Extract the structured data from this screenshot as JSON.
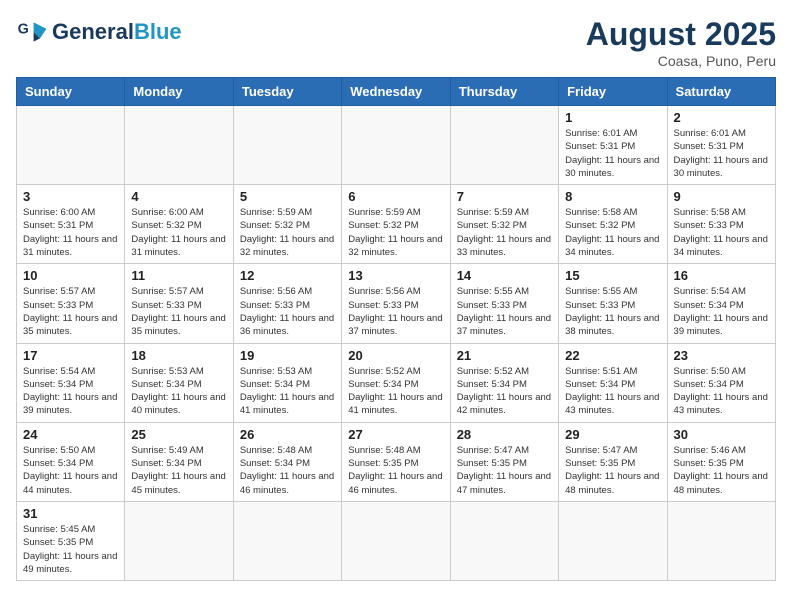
{
  "header": {
    "logo_general": "General",
    "logo_blue": "Blue",
    "title": "August 2025",
    "subtitle": "Coasa, Puno, Peru"
  },
  "days_of_week": [
    "Sunday",
    "Monday",
    "Tuesday",
    "Wednesday",
    "Thursday",
    "Friday",
    "Saturday"
  ],
  "weeks": [
    [
      {
        "day": "",
        "info": ""
      },
      {
        "day": "",
        "info": ""
      },
      {
        "day": "",
        "info": ""
      },
      {
        "day": "",
        "info": ""
      },
      {
        "day": "",
        "info": ""
      },
      {
        "day": "1",
        "info": "Sunrise: 6:01 AM\nSunset: 5:31 PM\nDaylight: 11 hours\nand 30 minutes."
      },
      {
        "day": "2",
        "info": "Sunrise: 6:01 AM\nSunset: 5:31 PM\nDaylight: 11 hours\nand 30 minutes."
      }
    ],
    [
      {
        "day": "3",
        "info": "Sunrise: 6:00 AM\nSunset: 5:31 PM\nDaylight: 11 hours\nand 31 minutes."
      },
      {
        "day": "4",
        "info": "Sunrise: 6:00 AM\nSunset: 5:32 PM\nDaylight: 11 hours\nand 31 minutes."
      },
      {
        "day": "5",
        "info": "Sunrise: 5:59 AM\nSunset: 5:32 PM\nDaylight: 11 hours\nand 32 minutes."
      },
      {
        "day": "6",
        "info": "Sunrise: 5:59 AM\nSunset: 5:32 PM\nDaylight: 11 hours\nand 32 minutes."
      },
      {
        "day": "7",
        "info": "Sunrise: 5:59 AM\nSunset: 5:32 PM\nDaylight: 11 hours\nand 33 minutes."
      },
      {
        "day": "8",
        "info": "Sunrise: 5:58 AM\nSunset: 5:32 PM\nDaylight: 11 hours\nand 34 minutes."
      },
      {
        "day": "9",
        "info": "Sunrise: 5:58 AM\nSunset: 5:33 PM\nDaylight: 11 hours\nand 34 minutes."
      }
    ],
    [
      {
        "day": "10",
        "info": "Sunrise: 5:57 AM\nSunset: 5:33 PM\nDaylight: 11 hours\nand 35 minutes."
      },
      {
        "day": "11",
        "info": "Sunrise: 5:57 AM\nSunset: 5:33 PM\nDaylight: 11 hours\nand 35 minutes."
      },
      {
        "day": "12",
        "info": "Sunrise: 5:56 AM\nSunset: 5:33 PM\nDaylight: 11 hours\nand 36 minutes."
      },
      {
        "day": "13",
        "info": "Sunrise: 5:56 AM\nSunset: 5:33 PM\nDaylight: 11 hours\nand 37 minutes."
      },
      {
        "day": "14",
        "info": "Sunrise: 5:55 AM\nSunset: 5:33 PM\nDaylight: 11 hours\nand 37 minutes."
      },
      {
        "day": "15",
        "info": "Sunrise: 5:55 AM\nSunset: 5:33 PM\nDaylight: 11 hours\nand 38 minutes."
      },
      {
        "day": "16",
        "info": "Sunrise: 5:54 AM\nSunset: 5:34 PM\nDaylight: 11 hours\nand 39 minutes."
      }
    ],
    [
      {
        "day": "17",
        "info": "Sunrise: 5:54 AM\nSunset: 5:34 PM\nDaylight: 11 hours\nand 39 minutes."
      },
      {
        "day": "18",
        "info": "Sunrise: 5:53 AM\nSunset: 5:34 PM\nDaylight: 11 hours\nand 40 minutes."
      },
      {
        "day": "19",
        "info": "Sunrise: 5:53 AM\nSunset: 5:34 PM\nDaylight: 11 hours\nand 41 minutes."
      },
      {
        "day": "20",
        "info": "Sunrise: 5:52 AM\nSunset: 5:34 PM\nDaylight: 11 hours\nand 41 minutes."
      },
      {
        "day": "21",
        "info": "Sunrise: 5:52 AM\nSunset: 5:34 PM\nDaylight: 11 hours\nand 42 minutes."
      },
      {
        "day": "22",
        "info": "Sunrise: 5:51 AM\nSunset: 5:34 PM\nDaylight: 11 hours\nand 43 minutes."
      },
      {
        "day": "23",
        "info": "Sunrise: 5:50 AM\nSunset: 5:34 PM\nDaylight: 11 hours\nand 43 minutes."
      }
    ],
    [
      {
        "day": "24",
        "info": "Sunrise: 5:50 AM\nSunset: 5:34 PM\nDaylight: 11 hours\nand 44 minutes."
      },
      {
        "day": "25",
        "info": "Sunrise: 5:49 AM\nSunset: 5:34 PM\nDaylight: 11 hours\nand 45 minutes."
      },
      {
        "day": "26",
        "info": "Sunrise: 5:48 AM\nSunset: 5:34 PM\nDaylight: 11 hours\nand 46 minutes."
      },
      {
        "day": "27",
        "info": "Sunrise: 5:48 AM\nSunset: 5:35 PM\nDaylight: 11 hours\nand 46 minutes."
      },
      {
        "day": "28",
        "info": "Sunrise: 5:47 AM\nSunset: 5:35 PM\nDaylight: 11 hours\nand 47 minutes."
      },
      {
        "day": "29",
        "info": "Sunrise: 5:47 AM\nSunset: 5:35 PM\nDaylight: 11 hours\nand 48 minutes."
      },
      {
        "day": "30",
        "info": "Sunrise: 5:46 AM\nSunset: 5:35 PM\nDaylight: 11 hours\nand 48 minutes."
      }
    ],
    [
      {
        "day": "31",
        "info": "Sunrise: 5:45 AM\nSunset: 5:35 PM\nDaylight: 11 hours\nand 49 minutes."
      },
      {
        "day": "",
        "info": ""
      },
      {
        "day": "",
        "info": ""
      },
      {
        "day": "",
        "info": ""
      },
      {
        "day": "",
        "info": ""
      },
      {
        "day": "",
        "info": ""
      },
      {
        "day": "",
        "info": ""
      }
    ]
  ]
}
